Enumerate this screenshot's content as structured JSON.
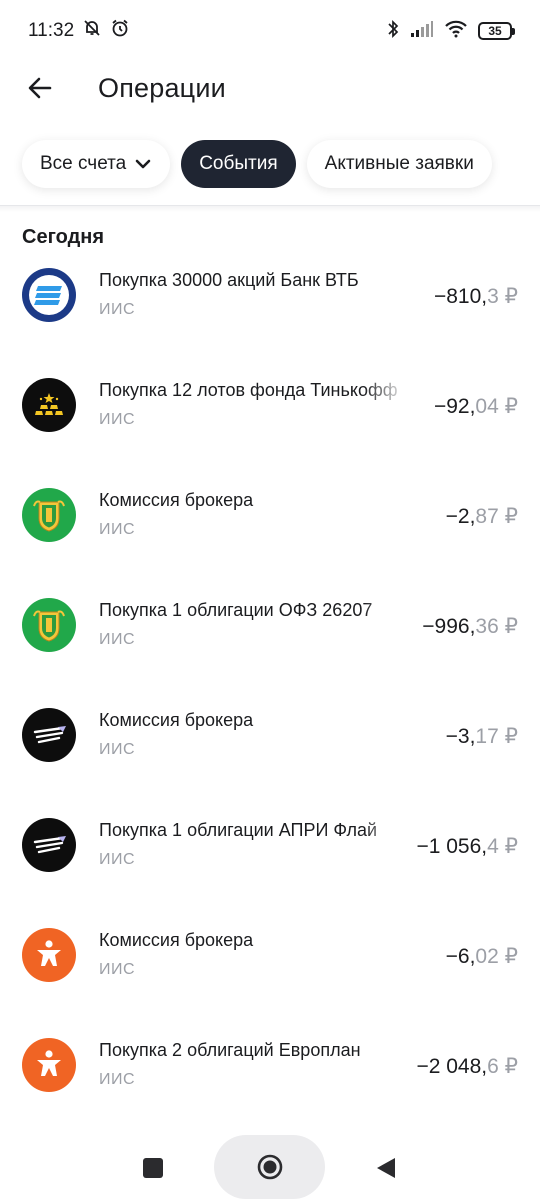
{
  "status_bar": {
    "time": "11:32",
    "battery": "35",
    "icons": [
      "silent-notifications-icon",
      "alarm-icon",
      "bluetooth-icon",
      "signal-icon",
      "wifi-icon",
      "battery-icon"
    ]
  },
  "header": {
    "title": "Операции",
    "back_icon": "arrow-left-icon"
  },
  "filters": {
    "accounts_label": "Все счета",
    "events_label": "События",
    "active_orders_label": "Активные заявки"
  },
  "section": {
    "title": "Сегодня"
  },
  "operations": [
    {
      "title": "Покупка 30000 акций Банк ВТБ",
      "account": "ИИС",
      "amount_int": "−810,",
      "amount_frac": "3",
      "currency": "₽",
      "logo": "vtb-logo"
    },
    {
      "title": "Покупка 12 лотов фонда Тинькофф",
      "account": "ИИС",
      "amount_int": "−92,",
      "amount_frac": "04",
      "currency": "₽",
      "logo": "gold-fund-logo"
    },
    {
      "title": "Комиссия брокера",
      "account": "ИИС",
      "amount_int": "−2,",
      "amount_frac": "87",
      "currency": "₽",
      "logo": "minfin-emblem-logo"
    },
    {
      "title": "Покупка 1 облигации ОФЗ 26207",
      "account": "ИИС",
      "amount_int": "−996,",
      "amount_frac": "36",
      "currency": "₽",
      "logo": "minfin-emblem-logo"
    },
    {
      "title": "Комиссия брокера",
      "account": "ИИС",
      "amount_int": "−3,",
      "amount_frac": "17",
      "currency": "₽",
      "logo": "apri-wings-logo"
    },
    {
      "title": "Покупка 1 облигации АПРИ Флай",
      "account": "ИИС",
      "amount_int": "−1 056,",
      "amount_frac": "4",
      "currency": "₽",
      "logo": "apri-wings-logo"
    },
    {
      "title": "Комиссия брокера",
      "account": "ИИС",
      "amount_int": "−6,",
      "amount_frac": "02",
      "currency": "₽",
      "logo": "europlan-logo"
    },
    {
      "title": "Покупка 2 облигаций Европлан",
      "account": "ИИС",
      "amount_int": "−2 048,",
      "amount_frac": "6",
      "currency": "₽",
      "logo": "europlan-logo"
    }
  ],
  "colors": {
    "active_chip": "#1f2532",
    "vtb_blue": "#1c3a87",
    "green": "#21a84a",
    "orange": "#f06424",
    "muted_text": "#9c9fa6"
  }
}
